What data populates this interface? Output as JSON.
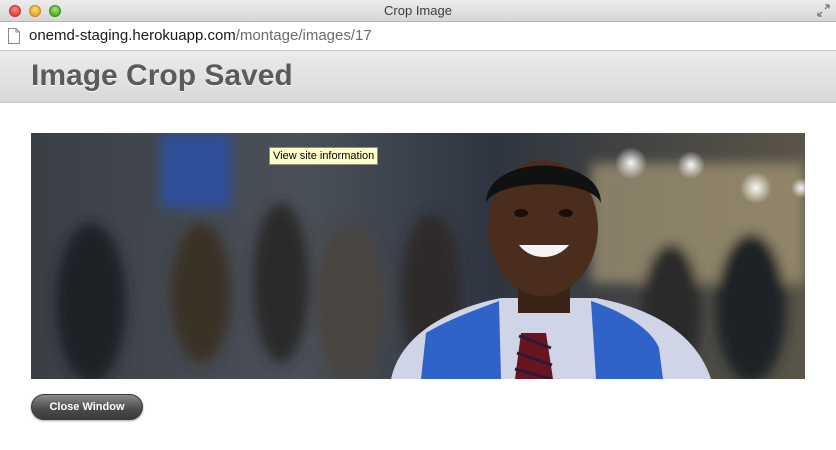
{
  "window": {
    "title": "Crop Image"
  },
  "address_bar": {
    "host": "onemd-staging.herokuapp.com",
    "path": "/montage/images/17",
    "icon": "page-icon"
  },
  "page": {
    "title": "Image Crop Saved"
  },
  "image": {
    "description_icon": "cropped-photo"
  },
  "tooltip": {
    "text": "View site information"
  },
  "actions": {
    "close_label": "Close Window"
  },
  "colors": {
    "title_text": "#5b5b5b",
    "button_bg": "#4a4a4a",
    "tooltip_bg": "#ffffc8",
    "stole_blue": "#2f63c8"
  }
}
